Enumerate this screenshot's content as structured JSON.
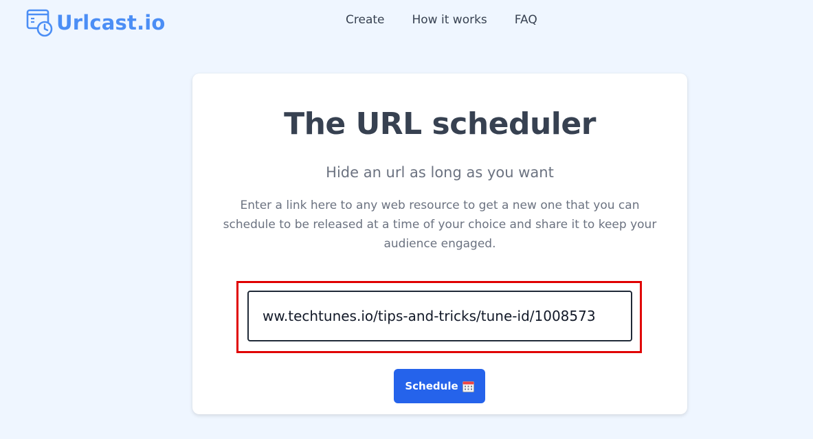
{
  "brand": {
    "name": "Urlcast.io",
    "icon": "browser-clock-icon",
    "color": "#4b8ef5"
  },
  "nav": {
    "items": [
      {
        "label": "Create"
      },
      {
        "label": "How it works"
      },
      {
        "label": "FAQ"
      }
    ]
  },
  "hero": {
    "title": "The URL scheduler",
    "subtitle": "Hide an url as long as you want",
    "description": "Enter a link here to any web resource to get a new one that you can schedule to be released at a time of your choice and share it to keep your audience engaged."
  },
  "form": {
    "url_value": "ww.techtunes.io/tips-and-tricks/tune-id/1008573",
    "highlight_color": "#e00000",
    "button_label": "Schedule",
    "button_icon": "calendar-icon",
    "button_color": "#2563eb"
  }
}
